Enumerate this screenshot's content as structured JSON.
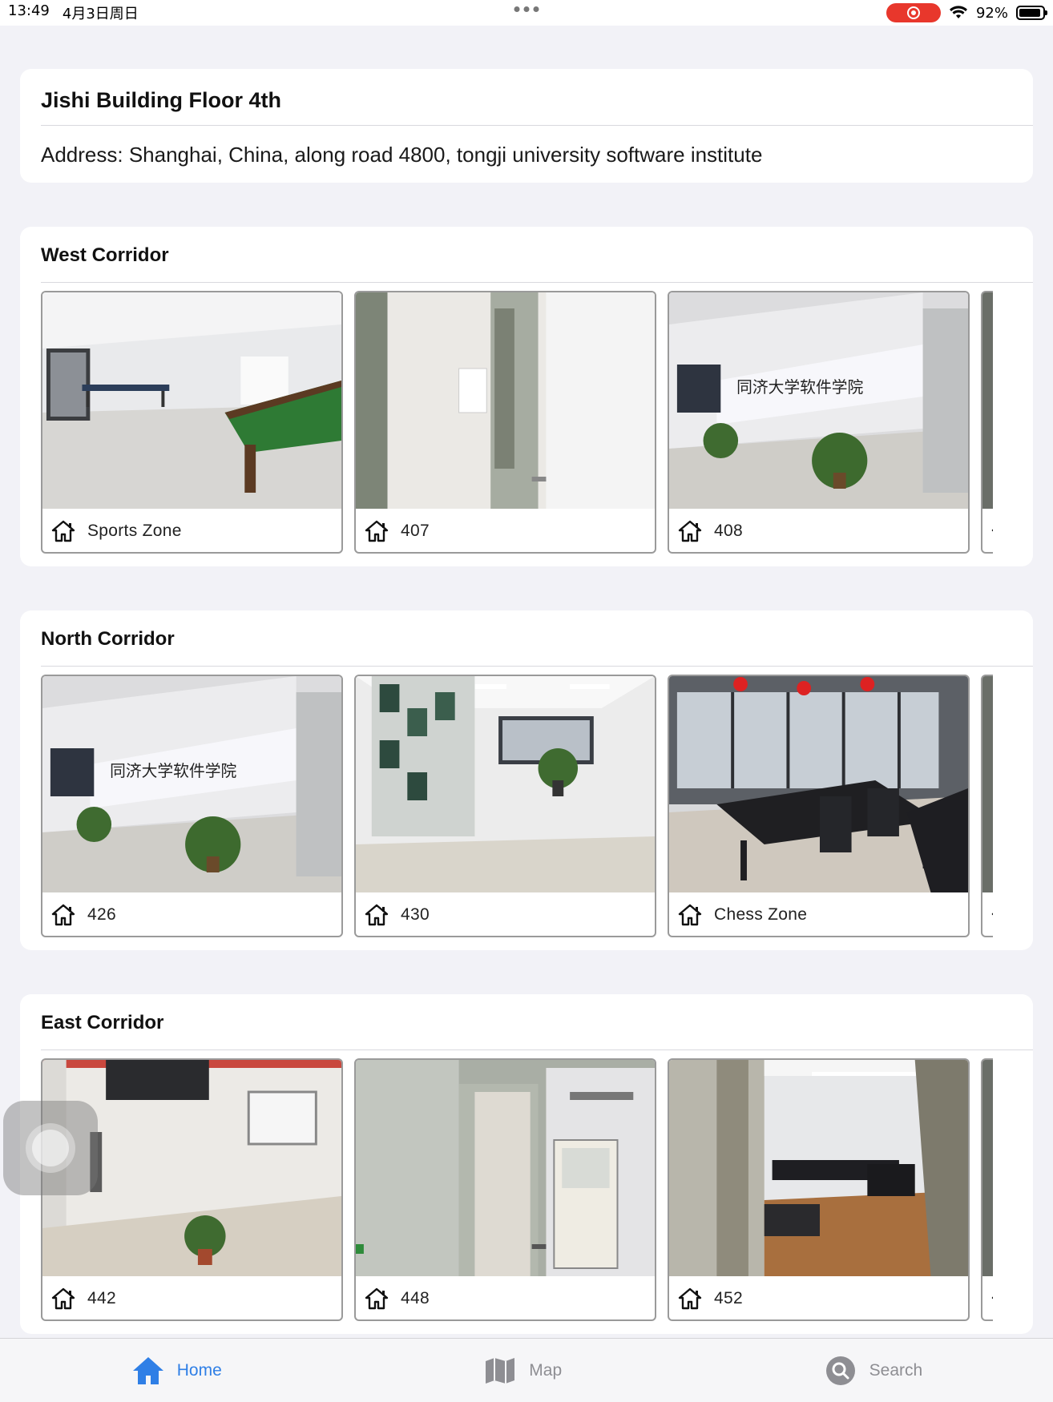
{
  "status_bar": {
    "time": "13:49",
    "date": "4月3日周日",
    "battery": "92%",
    "battery_level": 0.92
  },
  "header": {
    "title": "Jishi Building Floor 4th",
    "address": "Address: Shanghai, China, along road 4800, tongji university software institute"
  },
  "sections": [
    {
      "title": "West Corridor",
      "rooms": [
        {
          "label": "Sports Zone",
          "photo": "sports-room"
        },
        {
          "label": "407",
          "photo": "door"
        },
        {
          "label": "408",
          "photo": "sign-wall"
        }
      ]
    },
    {
      "title": "North Corridor",
      "rooms": [
        {
          "label": "426",
          "photo": "sign-wall"
        },
        {
          "label": "430",
          "photo": "lobby"
        },
        {
          "label": "Chess Zone",
          "photo": "chess-room"
        }
      ]
    },
    {
      "title": "East Corridor",
      "rooms": [
        {
          "label": "442",
          "photo": "whiteboard-hall"
        },
        {
          "label": "448",
          "photo": "open-door"
        },
        {
          "label": "452",
          "photo": "lounge"
        }
      ]
    }
  ],
  "tab_bar": {
    "home": "Home",
    "map": "Map",
    "search": "Search",
    "active_color": "#2f7fe6",
    "inactive_color": "#8e8e93"
  }
}
